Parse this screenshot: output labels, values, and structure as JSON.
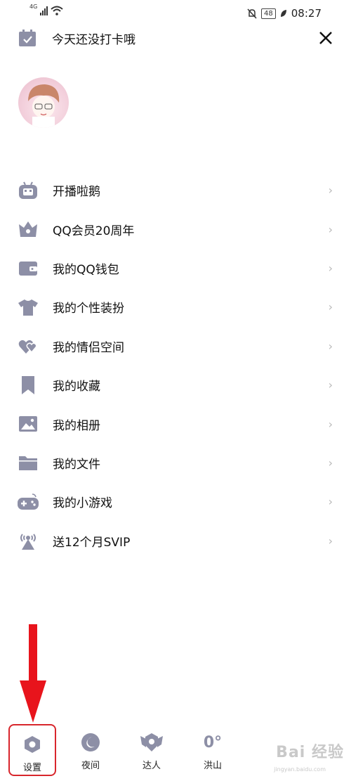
{
  "status_bar": {
    "network": "4G",
    "time": "08:27",
    "battery": "48"
  },
  "header": {
    "checkin_text": "今天还没打卡哦"
  },
  "menu": {
    "items": [
      {
        "label": "开播啦鹅",
        "icon": "tv-icon"
      },
      {
        "label": "QQ会员20周年",
        "icon": "crown-icon"
      },
      {
        "label": "我的QQ钱包",
        "icon": "wallet-icon"
      },
      {
        "label": "我的个性装扮",
        "icon": "tshirt-icon"
      },
      {
        "label": "我的情侣空间",
        "icon": "hearts-icon"
      },
      {
        "label": "我的收藏",
        "icon": "bookmark-icon"
      },
      {
        "label": "我的相册",
        "icon": "photo-icon"
      },
      {
        "label": "我的文件",
        "icon": "folder-icon"
      },
      {
        "label": "我的小游戏",
        "icon": "gamepad-icon"
      },
      {
        "label": "送12个月SVIP",
        "icon": "broadcast-icon"
      }
    ],
    "chevron": "›"
  },
  "bottom_bar": {
    "settings_label": "设置",
    "night_label": "夜间",
    "expert_label": "达人",
    "weather_label": "洪山",
    "weather_temp": "0°"
  },
  "colors": {
    "icon_gray": "#8d8fa6",
    "highlight_red": "#d8262c"
  }
}
